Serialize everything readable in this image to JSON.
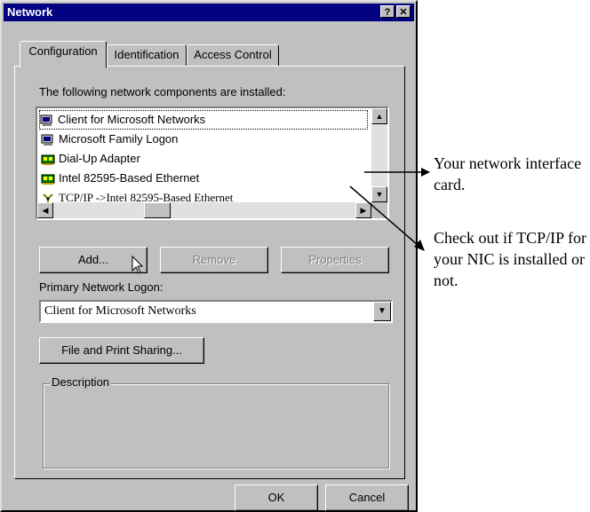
{
  "window": {
    "title": "Network",
    "help_button": "?",
    "close_button": "✕"
  },
  "tabs": [
    {
      "label": "Configuration",
      "active": true
    },
    {
      "label": "Identification",
      "active": false
    },
    {
      "label": "Access Control",
      "active": false
    }
  ],
  "components": {
    "heading": "The following network components are installed:",
    "items": [
      {
        "label": "Client for Microsoft Networks",
        "icon": "network-client-icon"
      },
      {
        "label": "Microsoft Family Logon",
        "icon": "network-client-icon"
      },
      {
        "label": "Dial-Up Adapter",
        "icon": "network-adapter-icon"
      },
      {
        "label": "Intel 82595-Based Ethernet",
        "icon": "network-adapter-icon"
      },
      {
        "label": "TCP/IP ->Intel 82595-Based Ethernet",
        "icon": "protocol-icon"
      }
    ]
  },
  "buttons": {
    "add": "Add...",
    "remove": "Remove",
    "properties": "Properties",
    "file_print_sharing": "File and Print Sharing...",
    "ok": "OK",
    "cancel": "Cancel"
  },
  "primary_logon": {
    "label": "Primary Network Logon:",
    "value": "Client for Microsoft Networks"
  },
  "description": {
    "label": "Description"
  },
  "annotations": {
    "nic": "Your network interface card.",
    "tcpip": "Check out if TCP/IP for your NIC is installed or not."
  },
  "colors": {
    "titlebar": "#000080",
    "dialog_face": "#c0c0c0"
  }
}
